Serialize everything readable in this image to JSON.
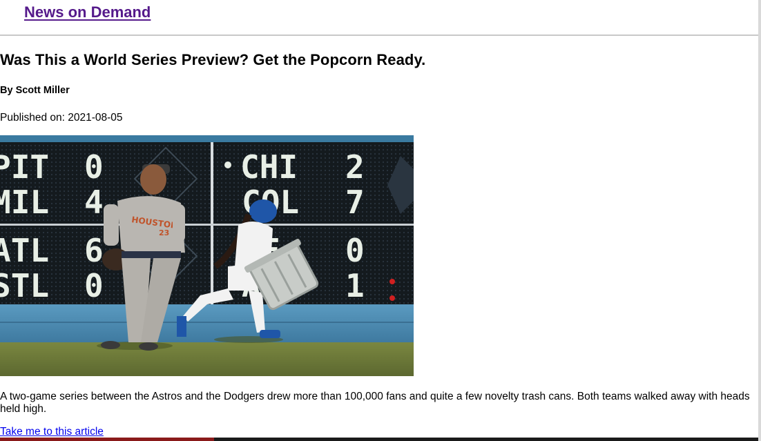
{
  "site": {
    "title": "News on Demand"
  },
  "article": {
    "headline": "Was This a World Series Preview? Get the Popcorn Ready.",
    "byline": "By Scott Miller",
    "published": "Published on: 2021-08-05",
    "summary": "A two-game series between the Astros and the Dodgers drew more than 100,000 fans and quite a few novelty trash cans. Both teams walked away with heads held high.",
    "link_label": "Take me to this article"
  },
  "photo": {
    "scoreboard": {
      "left_teams": [
        "PIT",
        "MIL",
        "ATL",
        "STL"
      ],
      "left_scores": [
        "0",
        "4",
        "6",
        "0"
      ],
      "right_teams": [
        "CHI",
        "COL",
        "SF",
        "AZ"
      ],
      "right_scores": [
        "2",
        "7",
        "0",
        "1"
      ]
    },
    "jersey_text": "HOUSTON",
    "jersey_number": "23",
    "colors": {
      "scoreboard": "#141a1e",
      "scoreboard_text": "#e8efe6",
      "wall": "#4f8db3",
      "grass": "#6d7a3a",
      "astros_uniform": "#b9b6b1",
      "dodgers_blue": "#1f56a8"
    }
  },
  "colors": {
    "visited_link": "#551a8b",
    "link": "#0000ee",
    "text": "#000000",
    "divider": "#c8c8c8"
  }
}
